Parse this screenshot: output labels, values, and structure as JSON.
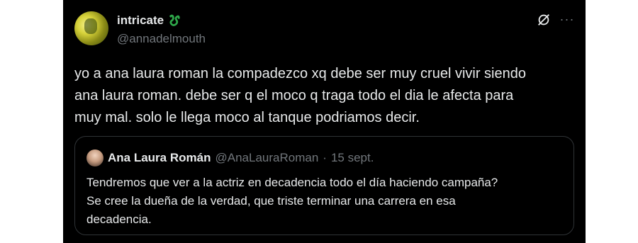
{
  "tweet": {
    "author": {
      "display_name": "intricate",
      "handle": "@annadelmouth",
      "name_emoji": "snake-emoji"
    },
    "text": "yo a ana laura roman la compadezco xq debe ser muy cruel vivir siendo\nana laura roman. debe ser q el moco q traga todo el dia le afecta para\nmuy mal. solo le llega moco al tanque podriamos decir.",
    "icons": [
      "grok-icon",
      "more-icon"
    ],
    "more_glyph": "···"
  },
  "quote": {
    "author": {
      "display_name": "Ana Laura Román",
      "handle": "@AnaLauraRoman",
      "separator": "·",
      "date": "15 sept."
    },
    "text": "Tendremos que ver a la actriz en decadencia todo el día haciendo campaña?\nSe cree la dueña de la verdad, que triste terminar una carrera en esa\ndecadencia."
  },
  "colors": {
    "background": "#000000",
    "text": "#e7e9ea",
    "secondary_text": "#71767b",
    "border": "#2f3336",
    "emoji_green": "#2ea84a"
  }
}
